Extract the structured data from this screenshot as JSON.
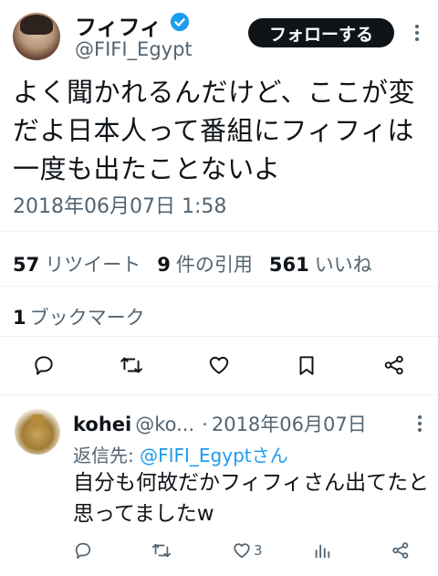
{
  "author": {
    "display_name": "フィフィ",
    "handle": "@FIFI_Egypt",
    "verified": true
  },
  "follow_button": {
    "label": "フォローする"
  },
  "tweet": {
    "text": "よく聞かれるんだけど、ここが変だよ日本人って番組にフィフィは一度も出たことないよ",
    "timestamp": "2018年06月07日 1:58"
  },
  "stats": {
    "retweets": {
      "count": "57",
      "label": "リツイート"
    },
    "quotes": {
      "count": "9",
      "label": "件の引用"
    },
    "likes": {
      "count": "561",
      "label": "いいね"
    },
    "bookmarks": {
      "count": "1",
      "label": "ブックマーク"
    }
  },
  "action_icons": [
    "reply-icon",
    "retweet-icon",
    "like-icon",
    "bookmark-icon",
    "share-icon"
  ],
  "reply": {
    "name": "kohei",
    "handle": "@ko...",
    "separator": "·",
    "date": "2018年06月07日",
    "replying_to_label": "返信先:",
    "replying_to_mention": "@FIFI_Egypt",
    "replying_to_suffix": "さん",
    "text": "自分も何故だかフィフィさん出てたと思ってましたw",
    "like_count": "3"
  },
  "colors": {
    "text": "#0f1419",
    "secondary": "#536471",
    "accent": "#1d9bf0",
    "follow_bg": "#0f1419",
    "divider": "#eff3f4"
  }
}
